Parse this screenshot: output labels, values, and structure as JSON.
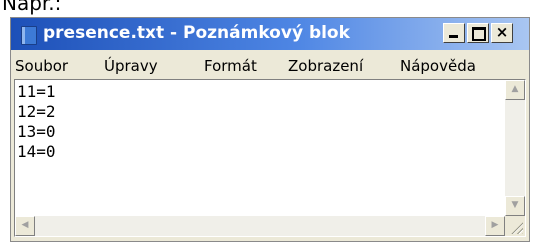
{
  "caption": "Např.:",
  "window": {
    "title": "presence.txt - Poznámkový blok",
    "minimize_glyph": "",
    "close_glyph": "×"
  },
  "menu": [
    "Soubor",
    "Úpravy",
    "Formát",
    "Zobrazení",
    "Nápověda"
  ],
  "editor": {
    "lines": [
      "11=1",
      "12=2",
      "13=0",
      "14=0"
    ]
  },
  "scrollbar": {
    "up_glyph": "▲",
    "down_glyph": "▼",
    "left_glyph": "◀",
    "right_glyph": "▶"
  },
  "colors": {
    "titlebar_start": "#1d50b8",
    "titlebar_end": "#a9c6f2",
    "window_face": "#ece9d8"
  }
}
